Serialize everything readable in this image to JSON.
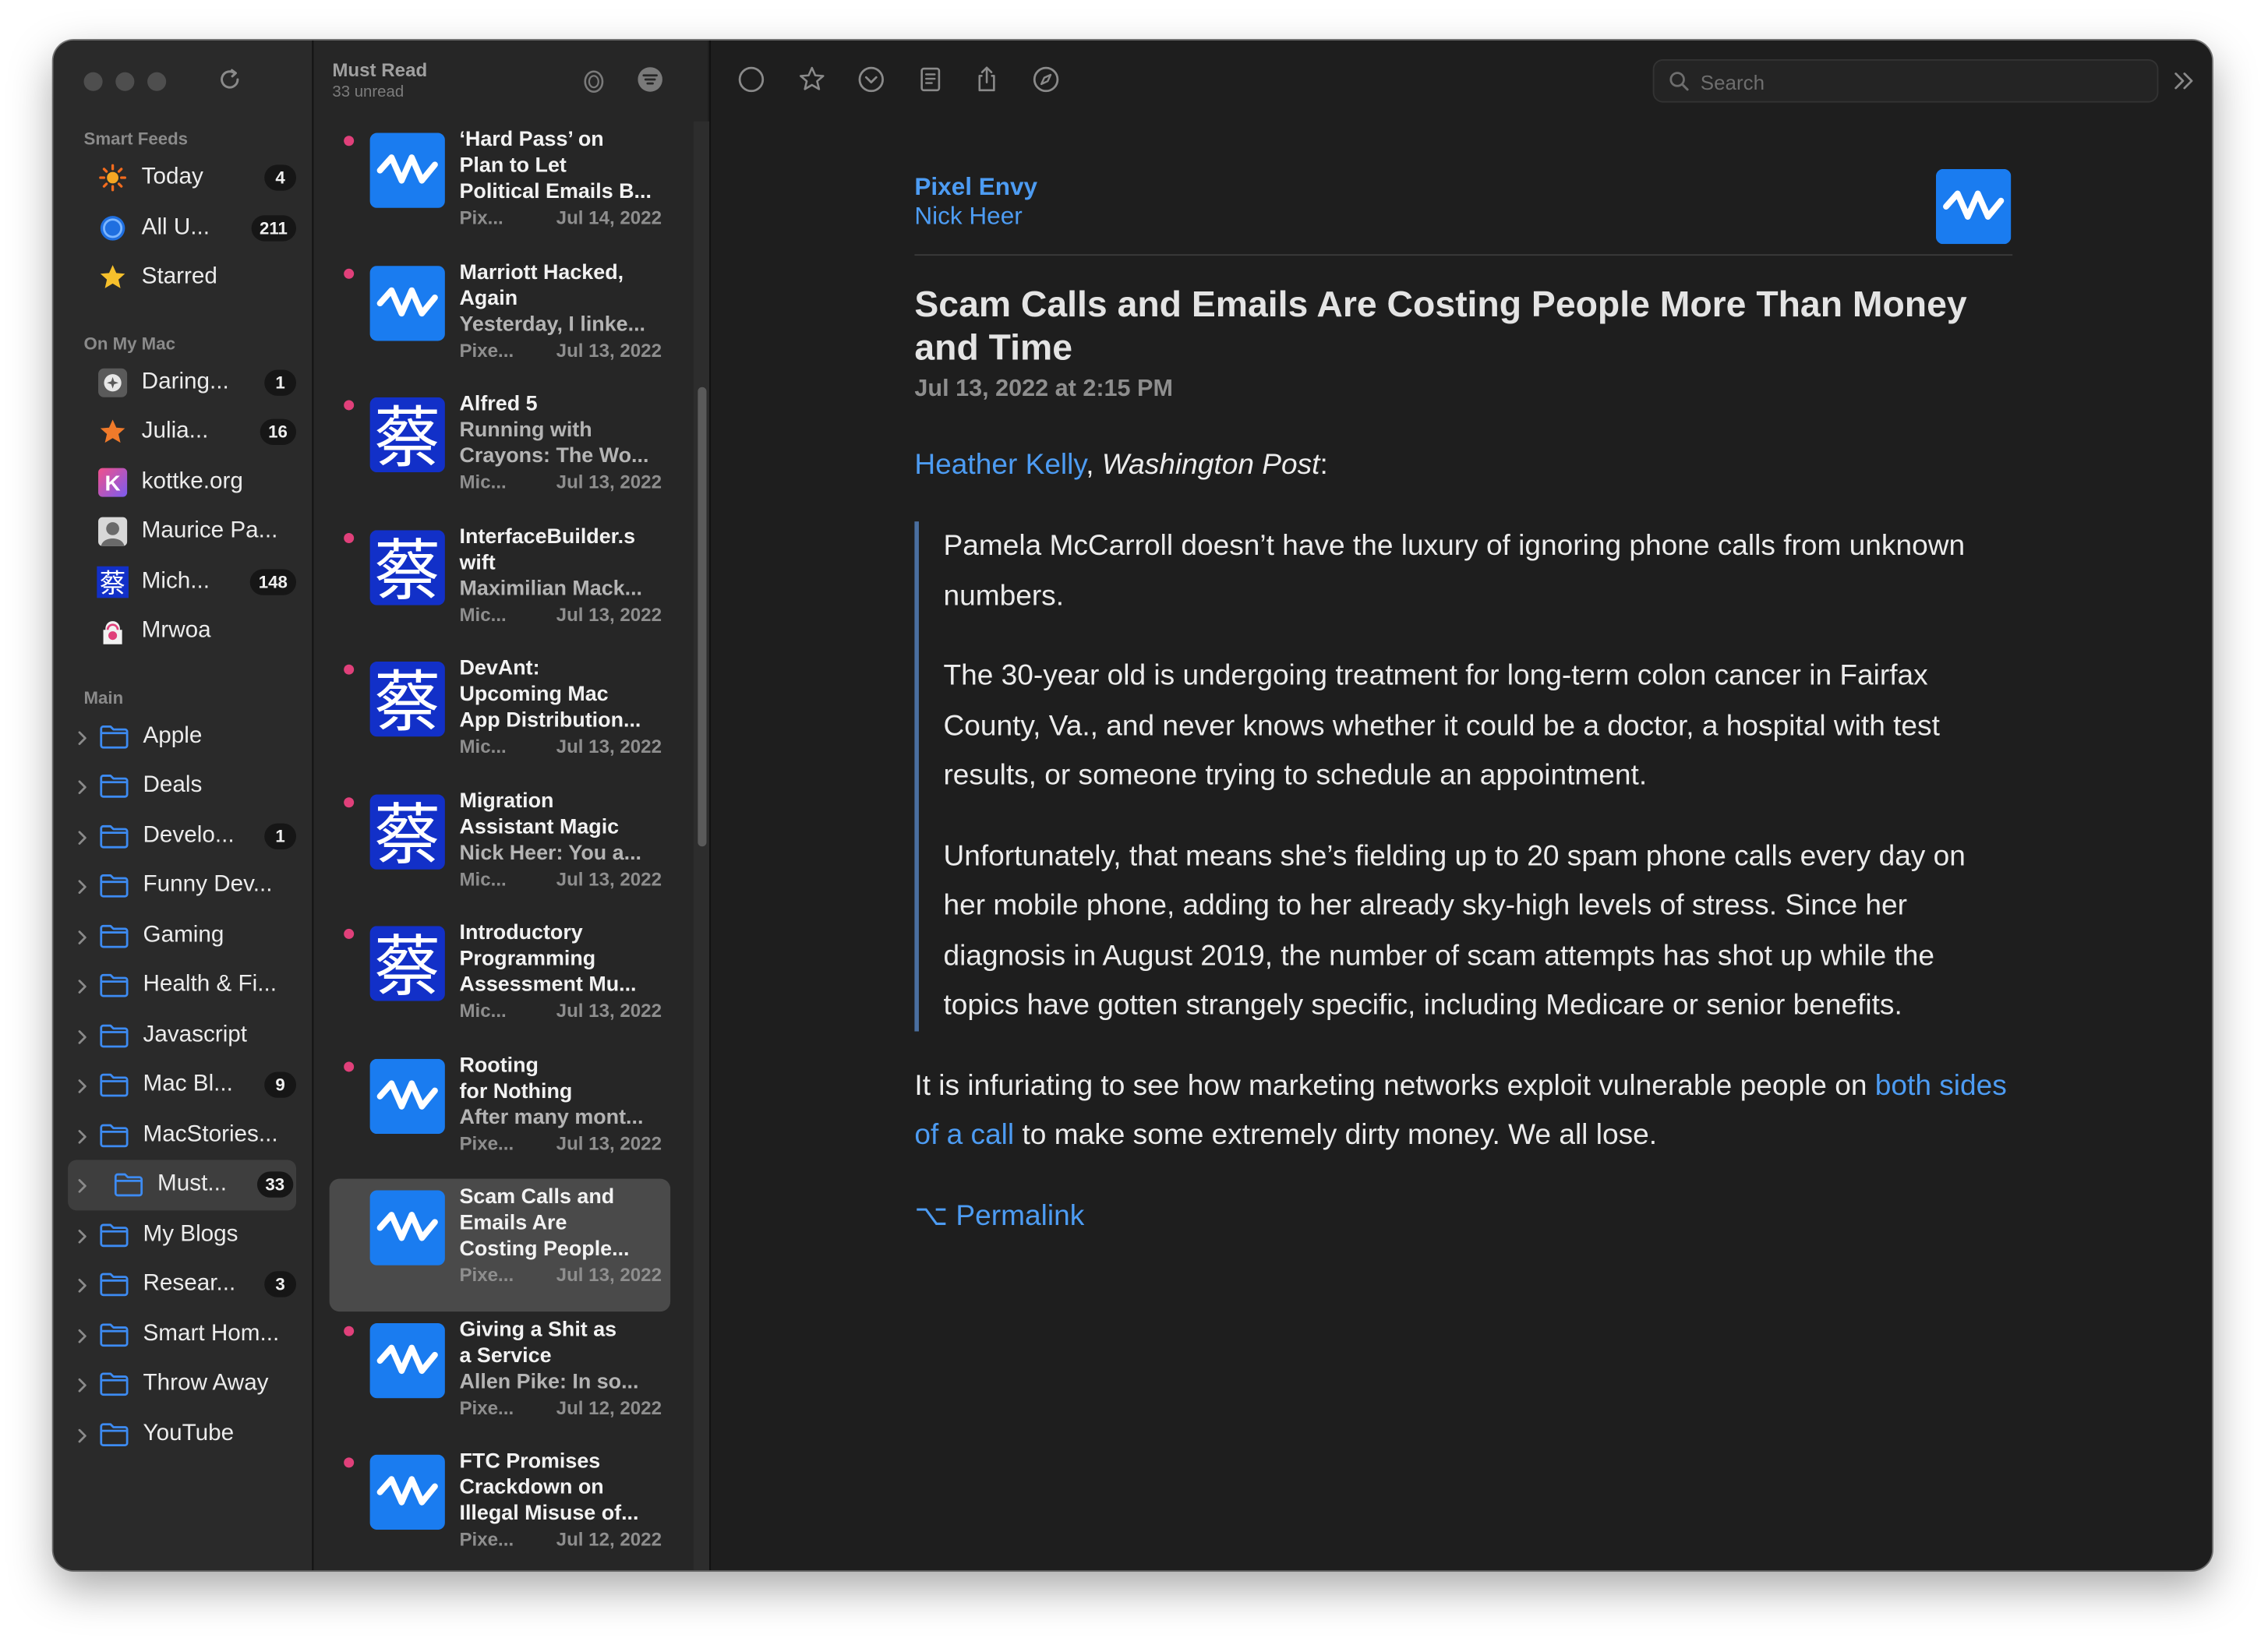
{
  "sidebar": {
    "sections": [
      {
        "title": "Smart Feeds",
        "items": [
          {
            "label": "Today",
            "badge": "4",
            "icon": "sun-icon"
          },
          {
            "label": "All U...",
            "badge": "211",
            "icon": "circle-icon"
          },
          {
            "label": "Starred",
            "badge": "",
            "icon": "star-icon"
          }
        ]
      },
      {
        "title": "On My Mac",
        "items": [
          {
            "label": "Daring...",
            "badge": "1",
            "icon": "daring-fireball-icon"
          },
          {
            "label": "Julia...",
            "badge": "16",
            "icon": "star-orange-icon"
          },
          {
            "label": "kottke.org",
            "badge": "",
            "icon": "kottke-icon"
          },
          {
            "label": "Maurice Pa...",
            "badge": "",
            "icon": "avatar-icon"
          },
          {
            "label": "Mich...",
            "badge": "148",
            "icon": "kanji-icon"
          },
          {
            "label": "Mrwoa",
            "badge": "",
            "icon": "mrwoa-icon"
          }
        ]
      },
      {
        "title": "Main",
        "items": [
          {
            "label": "Apple",
            "badge": ""
          },
          {
            "label": "Deals",
            "badge": ""
          },
          {
            "label": "Develo...",
            "badge": "1"
          },
          {
            "label": "Funny Dev...",
            "badge": ""
          },
          {
            "label": "Gaming",
            "badge": ""
          },
          {
            "label": "Health & Fi...",
            "badge": ""
          },
          {
            "label": "Javascript",
            "badge": ""
          },
          {
            "label": "Mac Bl...",
            "badge": "9"
          },
          {
            "label": "MacStories...",
            "badge": ""
          },
          {
            "label": "Must...",
            "badge": "33",
            "selected": true
          },
          {
            "label": "My Blogs",
            "badge": ""
          },
          {
            "label": "Resear...",
            "badge": "3"
          },
          {
            "label": "Smart Hom...",
            "badge": ""
          },
          {
            "label": "Throw Away",
            "badge": ""
          },
          {
            "label": "YouTube",
            "badge": ""
          }
        ]
      }
    ]
  },
  "list": {
    "title": "Must Read",
    "subtitle": "33 unread",
    "articles": [
      {
        "title_lines": [
          "‘Hard Pass’ on",
          "Plan to Let",
          "Political Emails B..."
        ],
        "snippet": "",
        "source": "Pix...",
        "date": "Jul 14, 2022",
        "thumb": "pixel-envy",
        "unread": true
      },
      {
        "title_lines": [
          "Marriott Hacked,",
          "Again"
        ],
        "snippet": "Yesterday, I linke...",
        "source": "Pixe...",
        "date": "Jul 13, 2022",
        "thumb": "pixel-envy",
        "unread": true
      },
      {
        "title_lines": [
          "Alfred 5"
        ],
        "snippet": "Running with\nCrayons: The Wo...",
        "source": "Mic...",
        "date": "Jul 13, 2022",
        "thumb": "kanji",
        "unread": true
      },
      {
        "title_lines": [
          "InterfaceBuilder.s",
          "wift"
        ],
        "snippet": "Maximilian Mack...",
        "source": "Mic...",
        "date": "Jul 13, 2022",
        "thumb": "kanji",
        "unread": true
      },
      {
        "title_lines": [
          "DevAnt:",
          "Upcoming Mac",
          "App Distribution..."
        ],
        "snippet": "",
        "source": "Mic...",
        "date": "Jul 13, 2022",
        "thumb": "kanji",
        "unread": true
      },
      {
        "title_lines": [
          "Migration",
          "Assistant Magic"
        ],
        "snippet": "Nick Heer: You a...",
        "source": "Mic...",
        "date": "Jul 13, 2022",
        "thumb": "kanji",
        "unread": true
      },
      {
        "title_lines": [
          "Introductory",
          "Programming",
          "Assessment Mu..."
        ],
        "snippet": "",
        "source": "Mic...",
        "date": "Jul 13, 2022",
        "thumb": "kanji",
        "unread": true
      },
      {
        "title_lines": [
          "Rooting",
          "for Nothing"
        ],
        "snippet": "After many mont...",
        "source": "Pixe...",
        "date": "Jul 13, 2022",
        "thumb": "pixel-envy",
        "unread": true
      },
      {
        "title_lines": [
          "Scam Calls and",
          "Emails Are",
          "Costing People..."
        ],
        "snippet": "",
        "source": "Pixe...",
        "date": "Jul 13, 2022",
        "thumb": "pixel-envy",
        "unread": false,
        "selected": true
      },
      {
        "title_lines": [
          "Giving a Shit as",
          "a Service"
        ],
        "snippet": "Allen Pike: In so...",
        "source": "Pixe...",
        "date": "Jul 12, 2022",
        "thumb": "pixel-envy",
        "unread": true
      },
      {
        "title_lines": [
          "FTC Promises",
          "Crackdown on",
          "Illegal Misuse of..."
        ],
        "snippet": "",
        "source": "Pixe...",
        "date": "Jul 12, 2022",
        "thumb": "pixel-envy",
        "unread": true
      }
    ]
  },
  "toolbar": {
    "search_placeholder": "Search"
  },
  "article": {
    "feed_name": "Pixel Envy",
    "author": "Nick Heer",
    "title": "Scam Calls and Emails Are Costing People More Than Money and Time",
    "date": "Jul 13, 2022 at 2:15 PM",
    "byline_link": "Heather Kelly",
    "byline_sep": ", ",
    "byline_pub": "Washington Post",
    "byline_colon": ":",
    "quote_paragraphs": [
      "Pamela McCarroll doesn’t have the luxury of ignoring phone calls from unknown numbers.",
      "The 30-year old is undergoing treatment for long-term colon cancer in Fairfax County, Va., and never knows whether it could be a doctor, a hospital with test results, or someone trying to schedule an appointment.",
      "Unfortunately, that means she’s fielding up to 20 spam phone calls every day on her mobile phone, adding to her already sky-high levels of stress. Since her diagnosis in August 2019, the number of scam attempts has shot up while the topics have gotten strangely specific, including Medicare or senior benefits."
    ],
    "body_before": "It is infuriating to see how marketing networks exploit vulnerable people on ",
    "body_link": "both sides of a call",
    "body_after": " to make some extremely dirty money. We all lose.",
    "permalink": "⌥ Permalink"
  },
  "colors": {
    "accent": "#4d9cf3",
    "unread_dot": "#e0407a",
    "pixel_envy_blue": "#1a7cf0",
    "kanji_blue": "#1230c8"
  },
  "kanji_glyph": "蔡",
  "kottke_letter": "K"
}
